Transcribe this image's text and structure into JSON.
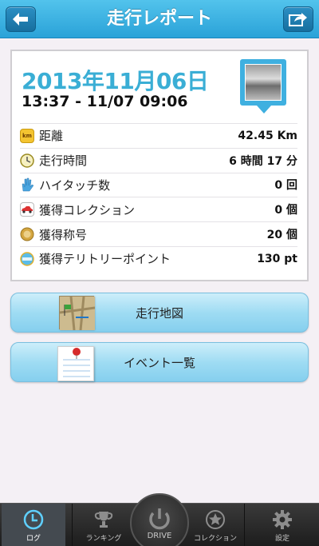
{
  "header": {
    "title": "走行レポート"
  },
  "report": {
    "date": "2013年11月06日",
    "time_range": "13:37 - 11/07 09:06",
    "rows": [
      {
        "icon": "km-icon",
        "icon_text": "km",
        "label": "距離",
        "value": "42.45 Km"
      },
      {
        "icon": "clock-icon",
        "label": "走行時間",
        "value": "6 時間 17 分"
      },
      {
        "icon": "high-five-icon",
        "label": "ハイタッチ数",
        "value": "0 回"
      },
      {
        "icon": "car-icon",
        "label": "獲得コレクション",
        "value": "0 個"
      },
      {
        "icon": "medal-icon",
        "label": "獲得称号",
        "value": "20 個"
      },
      {
        "icon": "spot-icon",
        "label": "獲得テリトリーポイント",
        "value": "130 pt"
      }
    ]
  },
  "actions": {
    "map_label": "走行地図",
    "events_label": "イベント一覧"
  },
  "tabbar": {
    "log": "ログ",
    "ranking": "ランキング",
    "drive": "DRIVE",
    "collection": "コレクション",
    "settings": "設定"
  }
}
